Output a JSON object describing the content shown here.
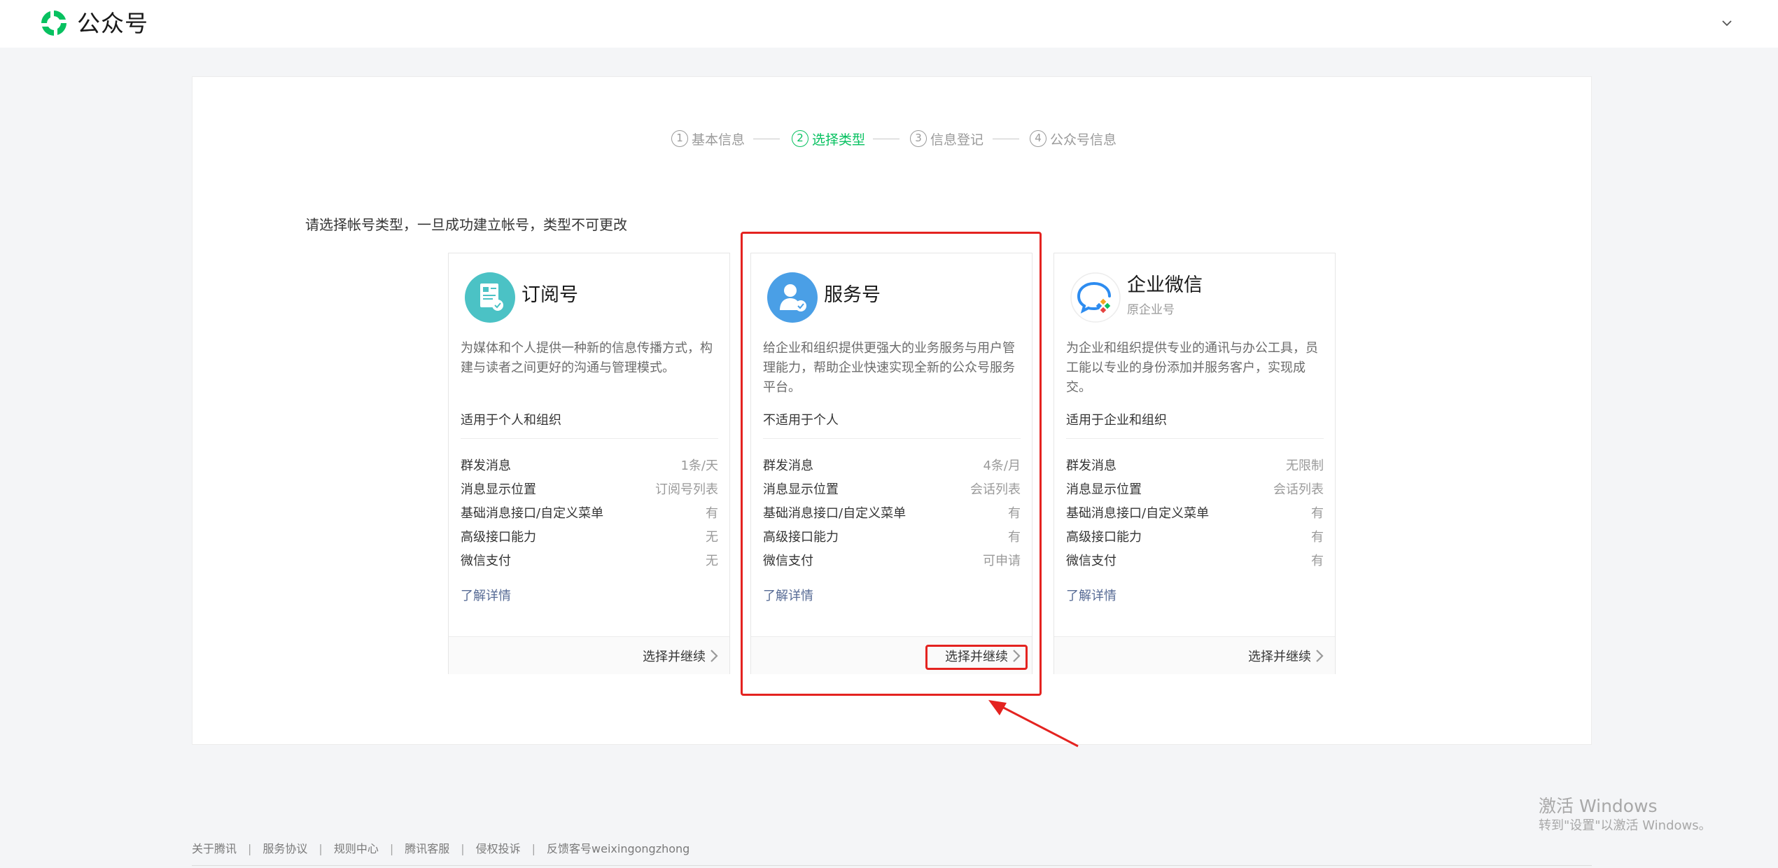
{
  "header": {
    "brand": "公众号",
    "logo_icon": "wechat-official-account-logo",
    "account_dropdown_icon": "chevron-down-icon"
  },
  "steps": [
    {
      "num": "1",
      "label": "基本信息",
      "active": false
    },
    {
      "num": "2",
      "label": "选择类型",
      "active": true
    },
    {
      "num": "3",
      "label": "信息登记",
      "active": false
    },
    {
      "num": "4",
      "label": "公众号信息",
      "active": false
    }
  ],
  "hint": "请选择帐号类型，一旦成功建立帐号，类型不可更改",
  "cards": [
    {
      "icon": "subscription-account-icon",
      "title": "订阅号",
      "subtitle": "",
      "desc": "为媒体和个人提供一种新的信息传播方式，构建与读者之间更好的沟通与管理模式。",
      "scope": "适用于个人和组织",
      "features": [
        {
          "name": "群发消息",
          "value": "1条/天"
        },
        {
          "name": "消息显示位置",
          "value": "订阅号列表"
        },
        {
          "name": "基础消息接口/自定义菜单",
          "value": "有"
        },
        {
          "name": "高级接口能力",
          "value": "无"
        },
        {
          "name": "微信支付",
          "value": "无"
        }
      ],
      "more": "了解详情",
      "select": "选择并继续"
    },
    {
      "icon": "service-account-icon",
      "title": "服务号",
      "subtitle": "",
      "desc": "给企业和组织提供更强大的业务服务与用户管理能力，帮助企业快速实现全新的公众号服务平台。",
      "scope": "不适用于个人",
      "features": [
        {
          "name": "群发消息",
          "value": "4条/月"
        },
        {
          "name": "消息显示位置",
          "value": "会话列表"
        },
        {
          "name": "基础消息接口/自定义菜单",
          "value": "有"
        },
        {
          "name": "高级接口能力",
          "value": "有"
        },
        {
          "name": "微信支付",
          "value": "可申请"
        }
      ],
      "more": "了解详情",
      "select": "选择并继续"
    },
    {
      "icon": "wecom-icon",
      "title": "企业微信",
      "subtitle": "原企业号",
      "desc": "为企业和组织提供专业的通讯与办公工具，员工能以专业的身份添加并服务客户，实现成交。",
      "scope": "适用于企业和组织",
      "features": [
        {
          "name": "群发消息",
          "value": "无限制"
        },
        {
          "name": "消息显示位置",
          "value": "会话列表"
        },
        {
          "name": "基础消息接口/自定义菜单",
          "value": "有"
        },
        {
          "name": "高级接口能力",
          "value": "有"
        },
        {
          "name": "微信支付",
          "value": "有"
        }
      ],
      "more": "了解详情",
      "select": "选择并继续"
    }
  ],
  "watermark": {
    "title": "激活 Windows",
    "subtitle": "转到\"设置\"以激活 Windows。"
  },
  "footer": {
    "links": [
      "关于腾讯",
      "服务协议",
      "规则中心",
      "腾讯客服",
      "侵权投诉",
      "反馈客号weixingongzhong"
    ]
  },
  "colors": {
    "brand_green": "#07c160",
    "link_blue": "#576b95",
    "annotation_red": "#e42320",
    "subscription_icon_bg": "#4bc2c5",
    "service_icon_bg": "#4a9fe6"
  }
}
